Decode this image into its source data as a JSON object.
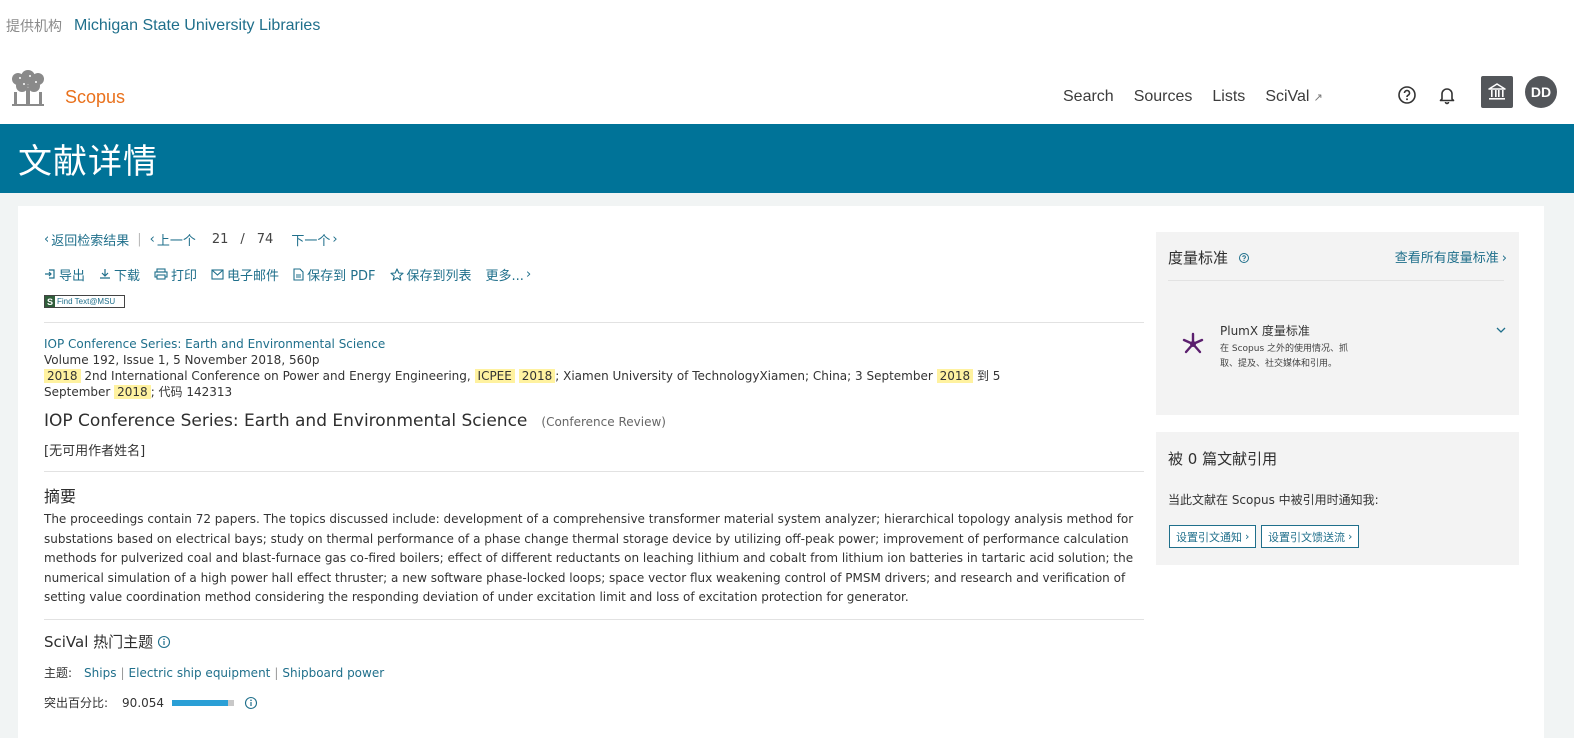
{
  "institution": {
    "label": "提供机构",
    "name": "Michigan State University Libraries"
  },
  "header": {
    "brand": "Scopus",
    "nav": [
      {
        "label": "Search"
      },
      {
        "label": "Sources"
      },
      {
        "label": "Lists"
      },
      {
        "label": "SciVal",
        "external": "↗"
      }
    ],
    "avatar_initials": "DD"
  },
  "page_title": "文献详情",
  "pager": {
    "back_label": "返回检索结果",
    "prev_label": "上一个",
    "current": "21",
    "slash": "/",
    "total": "74",
    "next_label": "下一个"
  },
  "actions": {
    "export": "导出",
    "download": "下载",
    "print": "打印",
    "email": "电子邮件",
    "save_pdf": "保存到 PDF",
    "save_list": "保存到列表",
    "more": "更多..."
  },
  "findtext": {
    "s": "S",
    "label": "Find Text@MSU"
  },
  "source": {
    "journal_link": "IOP Conference Series: Earth and Environmental Science",
    "volume_line": "Volume 192, Issue 1, 5 November 2018, 560p",
    "conf_year": "2018",
    "conf_name": " 2nd International Conference on Power and Energy Engineering, ",
    "conf_abbr": "ICPEE",
    "conf_year2": "2018",
    "conf_location": "; Xiamen University of TechnologyXiamen; China; 3 September ",
    "conf_year3": "2018",
    "conf_to": " 到 5",
    "line3_prefix": "September ",
    "conf_year4": "2018",
    "conf_code": "; 代码 142313"
  },
  "document": {
    "title": "IOP Conference Series: Earth and Environmental Science",
    "type": "(Conference Review)",
    "authors": "[无可用作者姓名]"
  },
  "abstract": {
    "heading": "摘要",
    "text": "The proceedings contain 72 papers. The topics discussed include: development of a comprehensive transformer material system analyzer; hierarchical topology analysis method for substations based on electrical bays; study on thermal performance of a phase change thermal storage device by utilizing off-peak power; improvement of performance calculation methods for pulverized coal and blast-furnace gas co-fired boilers; effect of different reductants on leaching lithium and cobalt from lithium ion batteries in tartaric acid solution; the numerical simulation of a high power hall effect thruster; a new software phase-locked loops; space vector flux weakening control of PMSM drivers; and research and verification of setting value coordination method considering the responding deviation of under excitation limit and loss of excitation protection for generator."
  },
  "scival": {
    "heading": "SciVal 热门主题",
    "topic_label": "主题:",
    "topics": [
      "Ships",
      "Electric ship equipment",
      "Shipboard power"
    ],
    "prominence_label": "突出百分比:",
    "prominence_value": "90.054",
    "prominence_fraction": 0.90054
  },
  "metrics": {
    "heading": "度量标准",
    "view_all": "查看所有度量标准",
    "plumx_title": "PlumX 度量标准",
    "plumx_desc": "在 Scopus 之外的使用情况、抓取、提及、社交媒体和引用。"
  },
  "cited_by": {
    "heading": "被 0 篇文献引用",
    "notify_text": "当此文献在 Scopus 中被引用时通知我:",
    "alert_button": "设置引文通知",
    "feed_button": "设置引文馈送流"
  },
  "colors": {
    "title_band": "#007398",
    "link": "#1f6f8b",
    "brand": "#e9711c",
    "highlight": "#fff2a0"
  }
}
